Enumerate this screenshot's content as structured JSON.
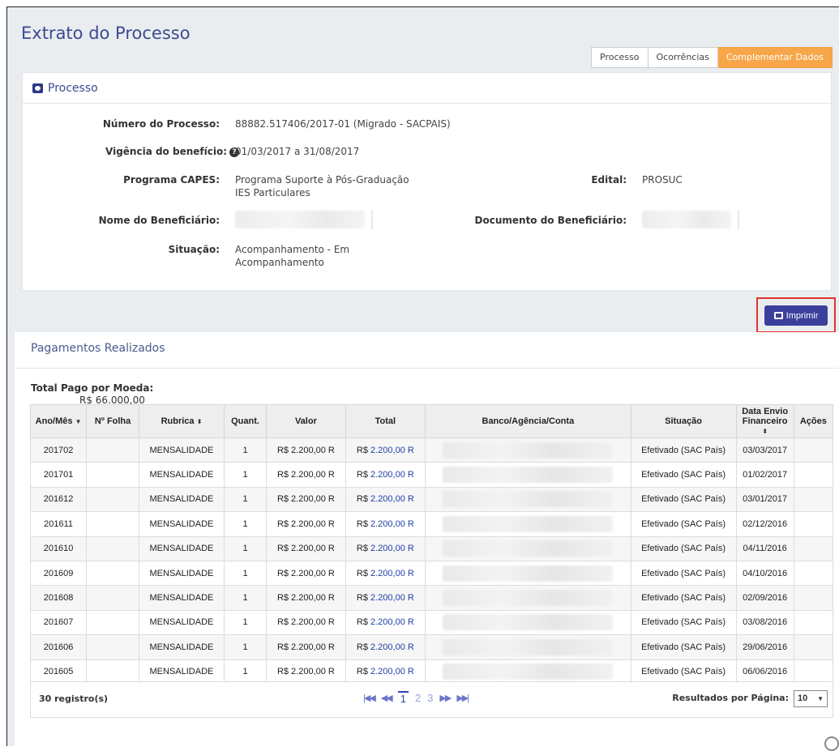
{
  "page": {
    "title": "Extrato do Processo"
  },
  "tabs": [
    {
      "label": "Processo"
    },
    {
      "label": "Ocorrências"
    },
    {
      "label": "Complementar Dados"
    }
  ],
  "processo": {
    "heading": "Processo",
    "numero_label": "Número do Processo:",
    "numero_value": "88882.517406/2017-01 (Migrado - SACPAIS)",
    "vigencia_label": "Vigência do benefício:",
    "vigencia_value": "01/03/2017 a 31/08/2017",
    "programa_label": "Programa CAPES:",
    "programa_value_line1": "Programa Suporte à Pós-Graduação",
    "programa_value_line2": "IES Particulares",
    "edital_label": "Edital:",
    "edital_value": "PROSUC",
    "beneficiario_label": "Nome do Beneficiário:",
    "documento_label": "Documento do Beneficiário:",
    "situacao_label": "Situação:",
    "situacao_line1": "Acompanhamento - Em",
    "situacao_line2": "Acompanhamento"
  },
  "print_button": {
    "label": "Imprimir"
  },
  "pagamentos": {
    "heading": "Pagamentos Realizados",
    "total_label": "Total Pago por Moeda:",
    "total_value": "R$ 66.000,00",
    "columns": [
      "Ano/Mês",
      "Nº Folha",
      "Rubrica",
      "Quant.",
      "Valor",
      "Total",
      "Banco/Agência/Conta",
      "Situação",
      "Data Envio",
      "Financeiro",
      "Ações"
    ],
    "rows": [
      {
        "ano_mes": "201702",
        "folha": "",
        "rubrica": "MENSALIDADE",
        "quant": "1",
        "valor": "R$ 2.200,00 R",
        "total_cur": "R$",
        "total": "2.200,00 R",
        "situacao": "Efetivado (SAC País)",
        "data": "03/03/2017"
      },
      {
        "ano_mes": "201701",
        "folha": "",
        "rubrica": "MENSALIDADE",
        "quant": "1",
        "valor": "R$ 2.200,00 R",
        "total_cur": "R$",
        "total": "2.200,00 R",
        "situacao": "Efetivado (SAC País)",
        "data": "01/02/2017"
      },
      {
        "ano_mes": "201612",
        "folha": "",
        "rubrica": "MENSALIDADE",
        "quant": "1",
        "valor": "R$ 2.200,00 R",
        "total_cur": "R$",
        "total": "2.200,00 R",
        "situacao": "Efetivado (SAC País)",
        "data": "03/01/2017"
      },
      {
        "ano_mes": "201611",
        "folha": "",
        "rubrica": "MENSALIDADE",
        "quant": "1",
        "valor": "R$ 2.200,00 R",
        "total_cur": "R$",
        "total": "2.200,00 R",
        "situacao": "Efetivado (SAC País)",
        "data": "02/12/2016"
      },
      {
        "ano_mes": "201610",
        "folha": "",
        "rubrica": "MENSALIDADE",
        "quant": "1",
        "valor": "R$ 2.200,00 R",
        "total_cur": "R$",
        "total": "2.200,00 R",
        "situacao": "Efetivado (SAC País)",
        "data": "04/11/2016"
      },
      {
        "ano_mes": "201609",
        "folha": "",
        "rubrica": "MENSALIDADE",
        "quant": "1",
        "valor": "R$ 2.200,00 R",
        "total_cur": "R$",
        "total": "2.200,00 R",
        "situacao": "Efetivado (SAC País)",
        "data": "04/10/2016"
      },
      {
        "ano_mes": "201608",
        "folha": "",
        "rubrica": "MENSALIDADE",
        "quant": "1",
        "valor": "R$ 2.200,00 R",
        "total_cur": "R$",
        "total": "2.200,00 R",
        "situacao": "Efetivado (SAC País)",
        "data": "02/09/2016"
      },
      {
        "ano_mes": "201607",
        "folha": "",
        "rubrica": "MENSALIDADE",
        "quant": "1",
        "valor": "R$ 2.200,00 R",
        "total_cur": "R$",
        "total": "2.200,00 R",
        "situacao": "Efetivado (SAC País)",
        "data": "03/08/2016"
      },
      {
        "ano_mes": "201606",
        "folha": "",
        "rubrica": "MENSALIDADE",
        "quant": "1",
        "valor": "R$ 2.200,00 R",
        "total_cur": "R$",
        "total": "2.200,00 R",
        "situacao": "Efetivado (SAC País)",
        "data": "29/06/2016"
      },
      {
        "ano_mes": "201605",
        "folha": "",
        "rubrica": "MENSALIDADE",
        "quant": "1",
        "valor": "R$ 2.200,00 R",
        "total_cur": "R$",
        "total": "2.200,00 R",
        "situacao": "Efetivado (SAC País)",
        "data": "06/06/2016"
      }
    ],
    "footer": {
      "count": "30 registro(s)",
      "pages": [
        "1",
        "2",
        "3"
      ],
      "per_page_label": "Resultados por Página:",
      "per_page_value": "10"
    }
  }
}
